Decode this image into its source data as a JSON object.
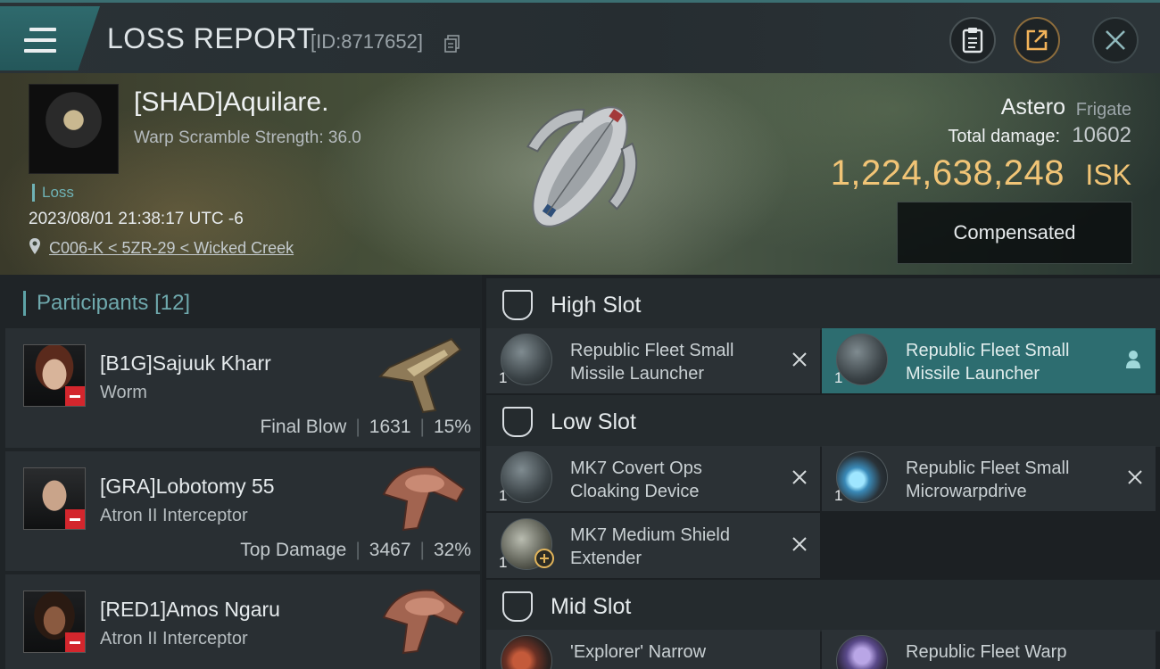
{
  "header": {
    "title": "LOSS REPORT",
    "report_id": "[ID:8717652]",
    "icons": [
      "menu-icon",
      "copy-icon",
      "clipboard-icon",
      "share-icon",
      "close-icon"
    ]
  },
  "victim": {
    "name": "[SHAD]Aquilare.",
    "warp_scramble": "Warp Scramble Strength: 36.0",
    "tag": "Loss",
    "time": "2023/08/01 21:38:17 UTC -6",
    "location": "C006-K < 5ZR-29 < Wicked Creek"
  },
  "ship": {
    "name": "Astero",
    "class": "Frigate",
    "total_damage_label": "Total damage:",
    "total_damage": "10602",
    "isk_value": "1,224,638,248",
    "isk_unit": "ISK",
    "status_button": "Compensated"
  },
  "participants": {
    "label": "Participants",
    "count": "[12]",
    "items": [
      {
        "name": "[B1G]Sajuuk Kharr",
        "ship": "Worm",
        "role": "Final Blow",
        "damage": "1631",
        "percent": "15%"
      },
      {
        "name": "[GRA]Lobotomy 55",
        "ship": "Atron II Interceptor",
        "role": "Top Damage",
        "damage": "3467",
        "percent": "32%"
      },
      {
        "name": "[RED1]Amos Ngaru",
        "ship": "Atron II Interceptor"
      }
    ]
  },
  "slots": {
    "high": {
      "title": "High Slot",
      "modules": [
        {
          "qty": "1",
          "line1": "Republic Fleet Small",
          "line2": "Missile Launcher"
        },
        {
          "qty": "1",
          "line1": "Republic Fleet Small",
          "line2": "Missile Launcher"
        }
      ]
    },
    "low": {
      "title": "Low Slot",
      "modules": [
        {
          "qty": "1",
          "line1": "MK7 Covert Ops",
          "line2": "Cloaking Device"
        },
        {
          "qty": "1",
          "line1": "Republic Fleet Small",
          "line2": "Microwarpdrive"
        },
        {
          "qty": "1",
          "line1": "MK7 Medium Shield",
          "line2": "Extender"
        }
      ]
    },
    "mid": {
      "title": "Mid Slot",
      "modules": [
        {
          "line1": "'Explorer' Narrow"
        },
        {
          "line1": "Republic Fleet Warp"
        }
      ]
    }
  },
  "colors": {
    "accent_teal": "#2d6d70",
    "isk_gold": "#f1c476",
    "loss_red": "#d3262d"
  }
}
